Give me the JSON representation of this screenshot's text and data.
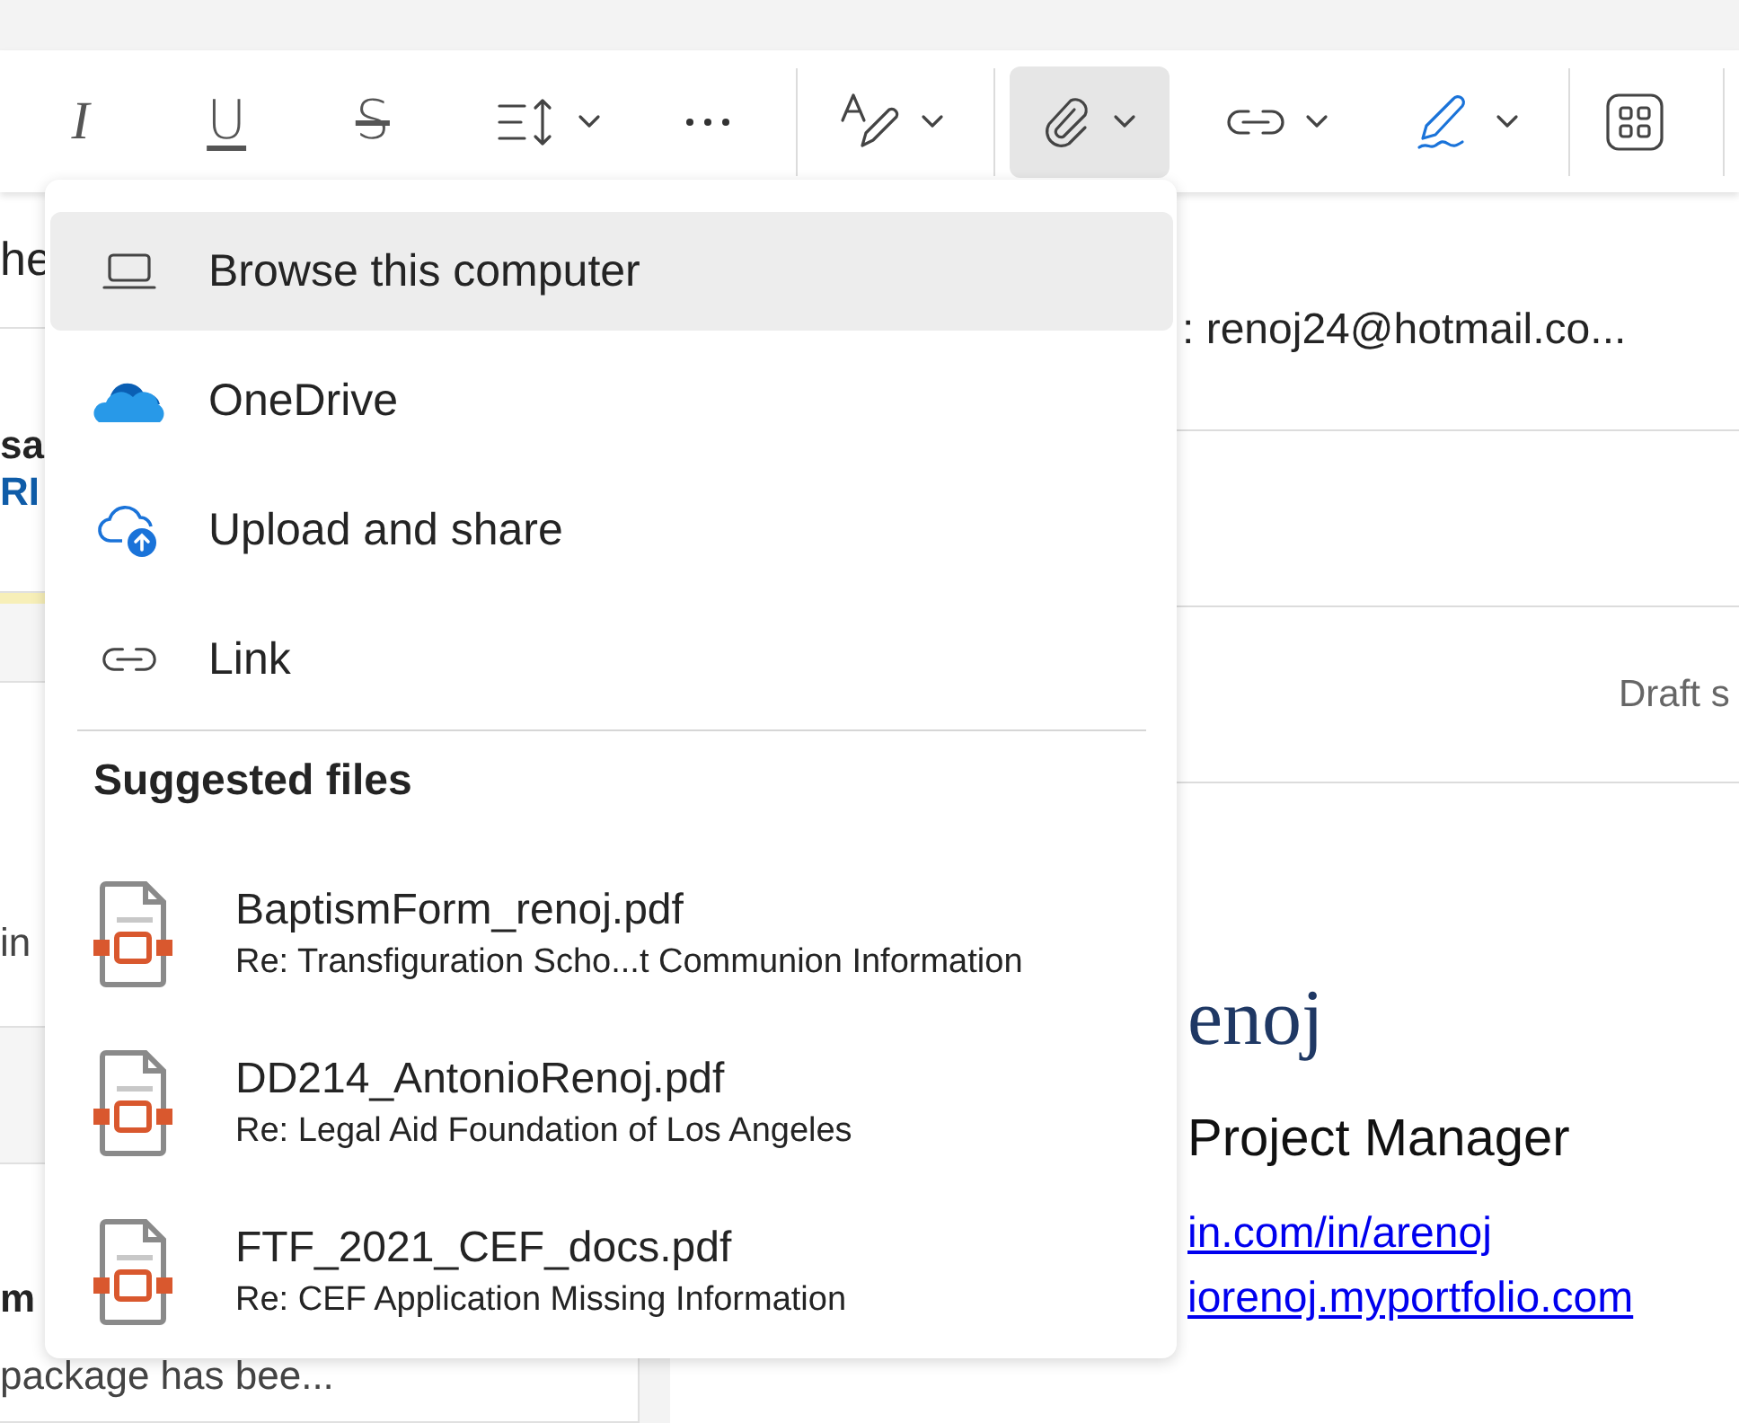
{
  "toolbar": {
    "buttons": [
      {
        "kind": "italic",
        "text": "I",
        "dropdown": false,
        "selected": false
      },
      {
        "kind": "underline",
        "text": "U",
        "dropdown": false,
        "selected": false
      },
      {
        "kind": "strike",
        "text": "S",
        "dropdown": false,
        "selected": false
      },
      {
        "kind": "spacing",
        "dropdown": true,
        "selected": false
      },
      {
        "kind": "more",
        "dropdown": false,
        "selected": false
      },
      {
        "kind": "separator"
      },
      {
        "kind": "textpen",
        "dropdown": true,
        "selected": false
      },
      {
        "kind": "separator"
      },
      {
        "kind": "attach",
        "dropdown": true,
        "selected": true
      },
      {
        "kind": "link",
        "dropdown": true,
        "selected": false
      },
      {
        "kind": "pen",
        "dropdown": true,
        "selected": false
      },
      {
        "kind": "separator"
      },
      {
        "kind": "apps",
        "dropdown": false,
        "selected": false
      },
      {
        "kind": "separator"
      }
    ]
  },
  "message_list": [
    {
      "kind": "message",
      "title": "he"
    },
    {
      "kind": "message",
      "sender": "sa",
      "tag": "RI"
    },
    {
      "kind": "band"
    },
    {
      "kind": "message",
      "preview": "in"
    },
    {
      "kind": "band"
    },
    {
      "kind": "message",
      "sender": "m",
      "preview": "package has bee..."
    }
  ],
  "compose": {
    "to": ": renoj24@hotmail.co...",
    "status": "Draft s",
    "signature": {
      "name": "enoj",
      "title": "Project Manager",
      "links": [
        "in.com/in/arenoj",
        "iorenoj.myportfolio.com"
      ]
    }
  },
  "attach_menu": {
    "items": [
      {
        "kind": "computer",
        "label": "Browse this computer",
        "selected": true
      },
      {
        "kind": "onedrive",
        "label": "OneDrive",
        "selected": false
      },
      {
        "kind": "upload",
        "label": "Upload and share",
        "selected": false
      },
      {
        "kind": "link",
        "label": "Link",
        "selected": false
      }
    ],
    "section_title": "Suggested files",
    "files": [
      {
        "name": "BaptismForm_renoj.pdf",
        "subtitle": "Re: Transfiguration Scho...t Communion Information"
      },
      {
        "name": "DD214_AntonioRenoj.pdf",
        "subtitle": "Re: Legal Aid Foundation of Los Angeles"
      },
      {
        "name": "FTF_2021_CEF_docs.pdf",
        "subtitle": "Re: CEF Application Missing Information"
      }
    ]
  }
}
